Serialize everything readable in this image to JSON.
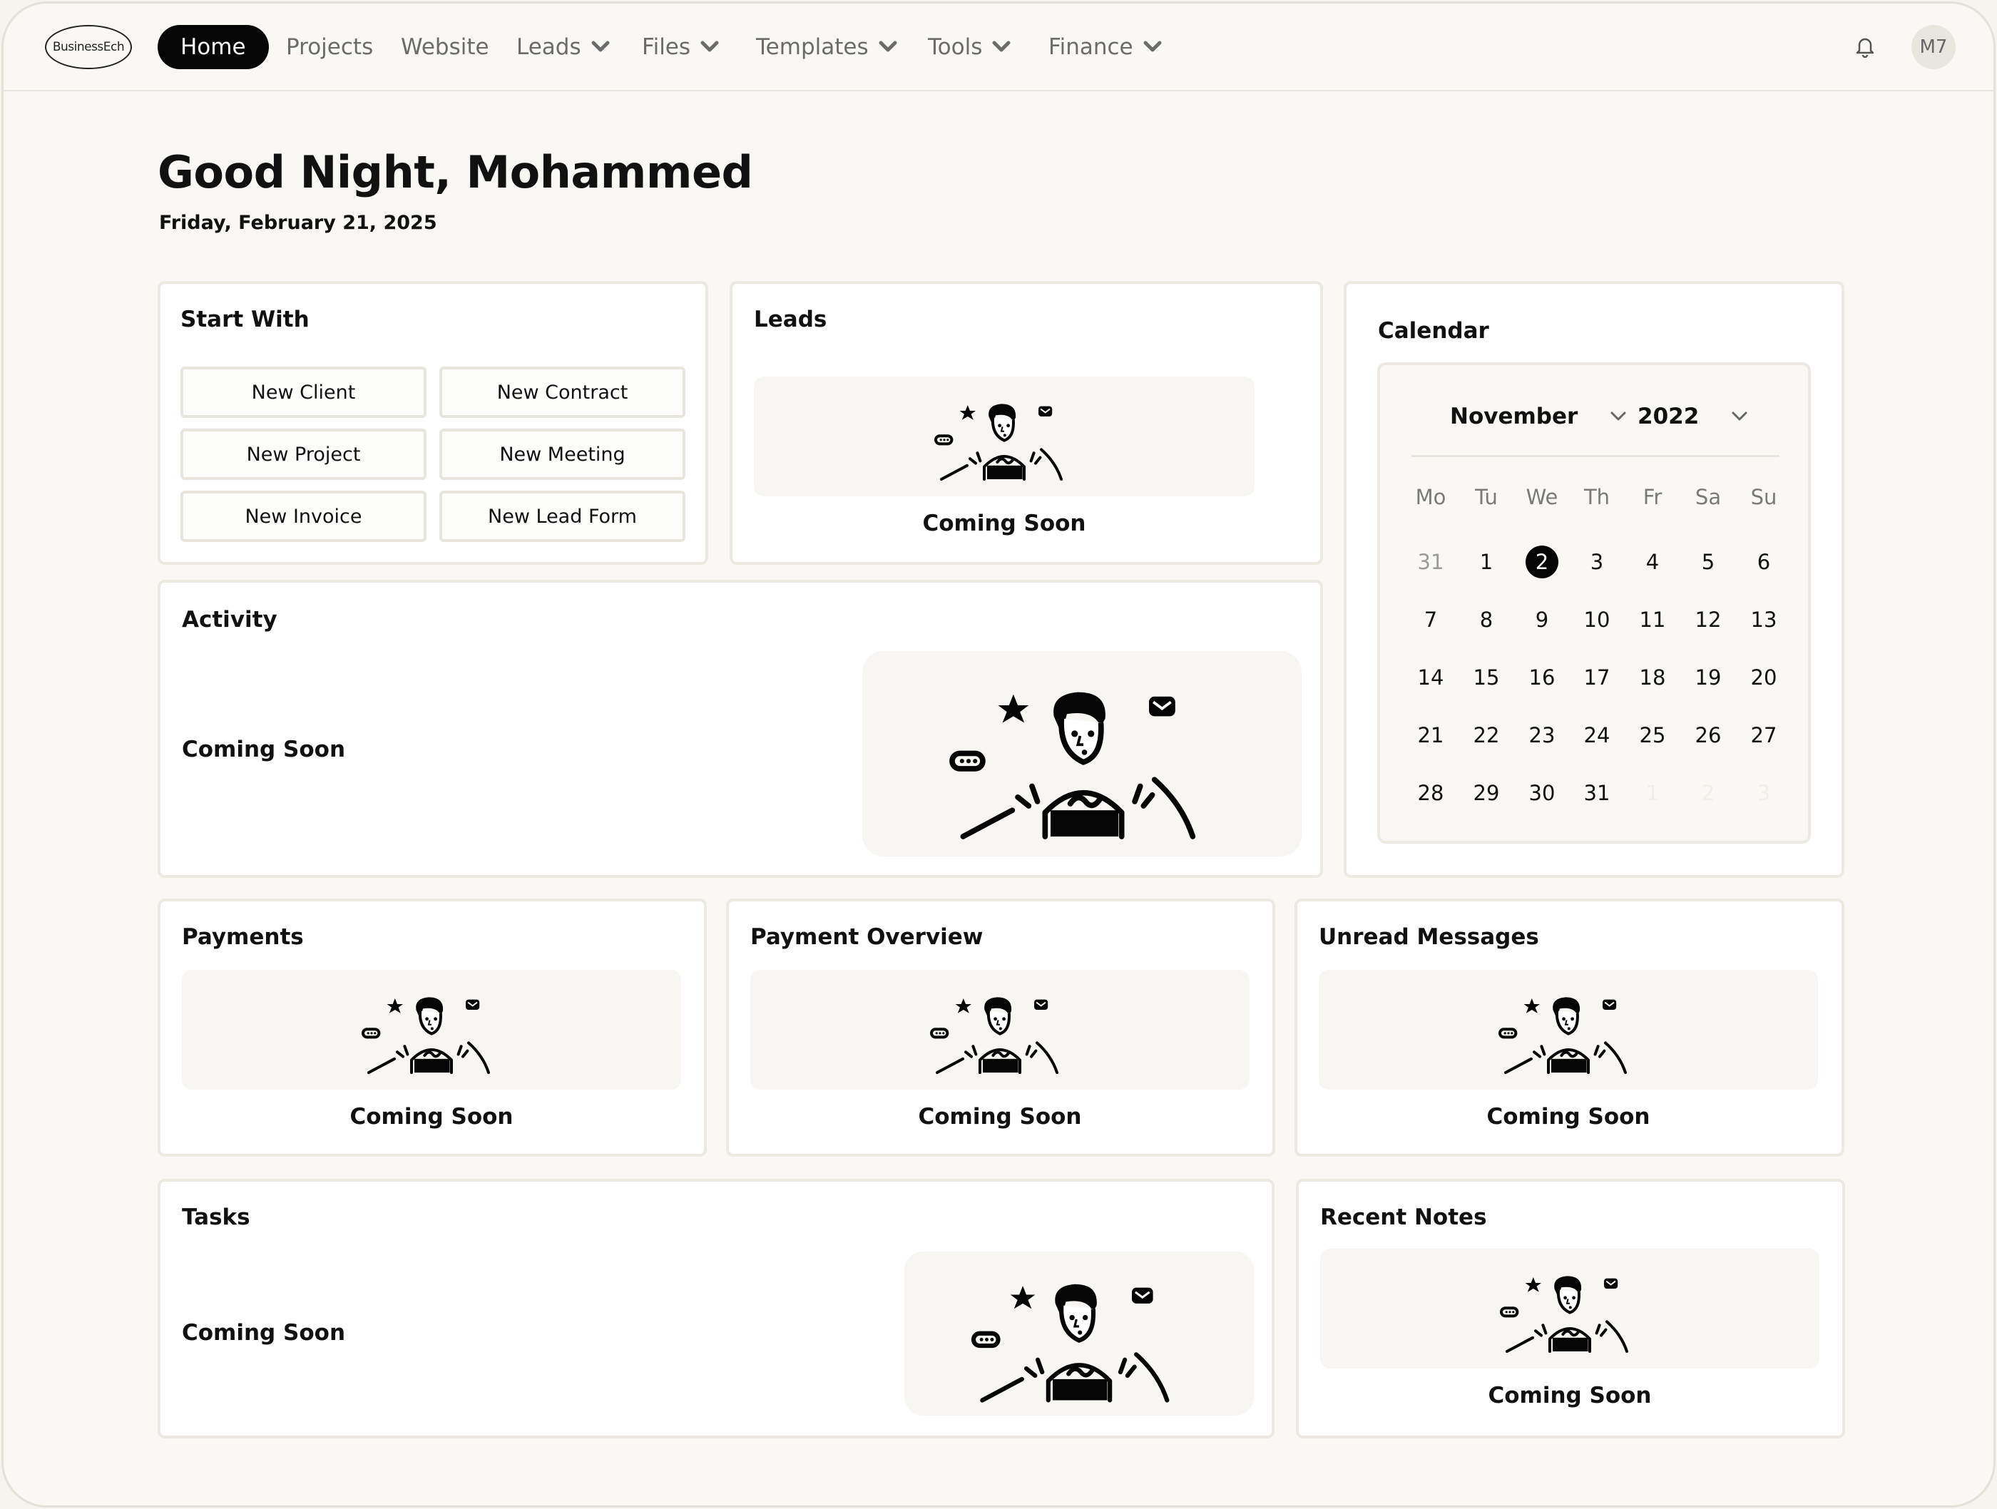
{
  "nav": {
    "logo_text": "BusinessEch",
    "items": [
      {
        "label": "Home",
        "active": true
      },
      {
        "label": "Projects"
      },
      {
        "label": "Website"
      },
      {
        "label": "Leads",
        "dropdown": true
      },
      {
        "label": "Files",
        "dropdown": true
      },
      {
        "label": "Templates",
        "dropdown": true
      },
      {
        "label": "Tools",
        "dropdown": true
      },
      {
        "label": "Finance",
        "dropdown": true
      }
    ],
    "notification_icon": "bell-icon",
    "avatar_initials": "M7"
  },
  "greeting": {
    "title": "Good Night, Mohammed",
    "date": "Friday, February 21, 2025"
  },
  "start_with": {
    "title": "Start With",
    "buttons": [
      "New Client",
      "New Contract",
      "New Project",
      "New Meeting",
      "New Invoice",
      "New Lead Form"
    ]
  },
  "leads": {
    "title": "Leads",
    "status": "Coming Soon"
  },
  "activity": {
    "title": "Activity",
    "status": "Coming Soon"
  },
  "calendar": {
    "title": "Calendar",
    "month": "November",
    "year": "2022",
    "weekdays": [
      "Mo",
      "Tu",
      "We",
      "Th",
      "Fr",
      "Sa",
      "Su"
    ],
    "weeks": [
      [
        "31",
        "1",
        "2",
        "3",
        "4",
        "5",
        "6"
      ],
      [
        "7",
        "8",
        "9",
        "10",
        "11",
        "12",
        "13"
      ],
      [
        "14",
        "15",
        "16",
        "17",
        "18",
        "19",
        "20"
      ],
      [
        "21",
        "22",
        "23",
        "24",
        "25",
        "26",
        "27"
      ],
      [
        "28",
        "29",
        "30",
        "31",
        "1",
        "2",
        "3"
      ]
    ],
    "selected_day": "2"
  },
  "payments": {
    "title": "Payments",
    "status": "Coming Soon"
  },
  "payment_overview": {
    "title": "Payment Overview",
    "status": "Coming Soon"
  },
  "unread_messages": {
    "title": "Unread Messages",
    "status": "Coming Soon"
  },
  "tasks": {
    "title": "Tasks",
    "status": "Coming Soon"
  },
  "recent_notes": {
    "title": "Recent Notes",
    "status": "Coming Soon"
  },
  "colors": {
    "background": "#f9f8f5",
    "card": "#ffffff",
    "border": "#ebe9e1",
    "accent": "#050505",
    "muted_text": "#6b6b6b"
  }
}
